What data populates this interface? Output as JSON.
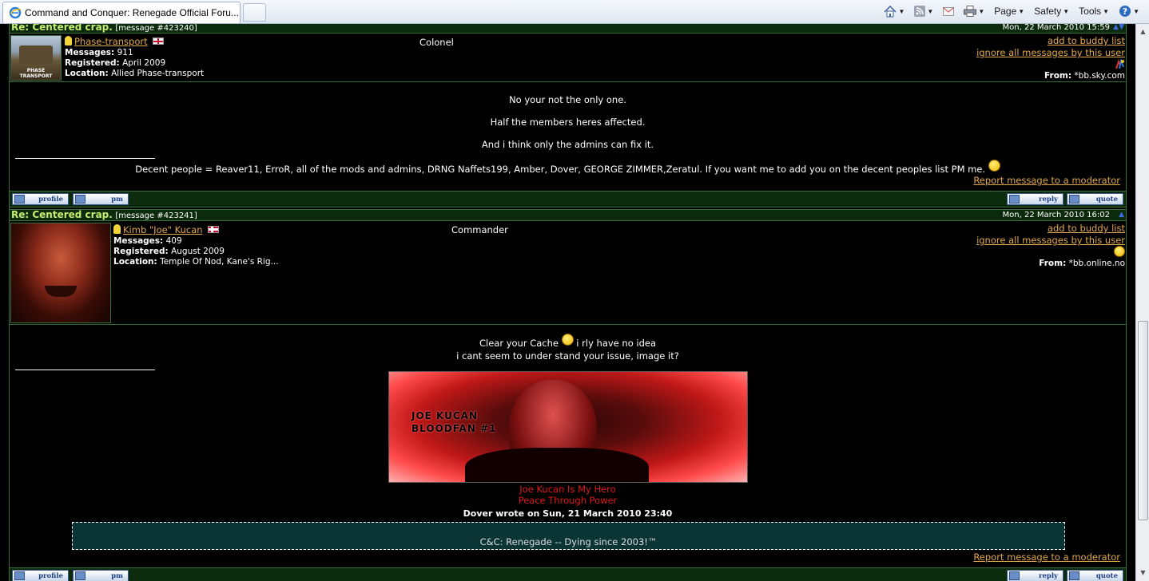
{
  "browser": {
    "tab_title": "Command and Conquer: Renegade Official Foru...",
    "toolbar": {
      "page": "Page",
      "safety": "Safety",
      "tools": "Tools"
    }
  },
  "post1": {
    "subject": "Re: Centered crap.",
    "message_no": "[message #423240]",
    "date": "Mon, 22 March 2010 15:59",
    "username": "Phase-transport",
    "avatar_text": "PHASE TRANSPORT",
    "messages_label": "Messages:",
    "messages": "911",
    "registered_label": "Registered:",
    "registered": "April 2009",
    "location_label": "Location:",
    "location": "Allied Phase-transport",
    "rank": "Colonel",
    "buddy_link": "add to buddy list",
    "ignore_link": "ignore all messages by this user",
    "from_label": "From:",
    "from": "*bb.sky.com",
    "lines": [
      "No your not the only one.",
      "Half the members heres affected.",
      "And i think only the admins can fix it."
    ],
    "signature": "Decent people = Reaver11, ErroR, all of the mods and admins, DRNG Naffets199, Amber, Dover, GEORGE ZIMMER,Zeratul. If you want me to add you on the decent peoples list PM me.",
    "report": "Report message to a moderator"
  },
  "post2": {
    "subject": "Re: Centered crap.",
    "message_no": "[message #423241]",
    "date": "Mon, 22 March 2010 16:02",
    "username": "Kimb \"Joe\" Kucan",
    "messages_label": "Messages:",
    "messages": "409",
    "registered_label": "Registered:",
    "registered": "August 2009",
    "location_label": "Location:",
    "location": "Temple Of Nod, Kane's Rig...",
    "rank": "Commander",
    "buddy_link": "add to buddy list",
    "ignore_link": "ignore all messages by this user",
    "from_label": "From:",
    "from": "*bb.online.no",
    "line1": "Clear your Cache",
    "line1b": "i rly have no idea",
    "line2": "i cant seem to under stand your issue, image it?",
    "banner_line1": "JOE KUCAN",
    "banner_line2": "BLOODFAN #1",
    "sig_red1": "Joe Kucan Is My Hero",
    "sig_red2": "Peace Through Power",
    "quote_header": "Dover wrote on Sun, 21 March 2010 23:40",
    "quote_text": "C&C: Renegade -- Dying since 2003!™",
    "report": "Report message to a moderator"
  },
  "buttons": {
    "profile": "profile",
    "pm": "pm",
    "reply": "reply",
    "quote": "quote"
  },
  "colors": {
    "accent_link": "#e2a74c",
    "header_green": "#0c2a0c",
    "subject_text": "#c9ee6e",
    "signature_red": "#e01818"
  }
}
